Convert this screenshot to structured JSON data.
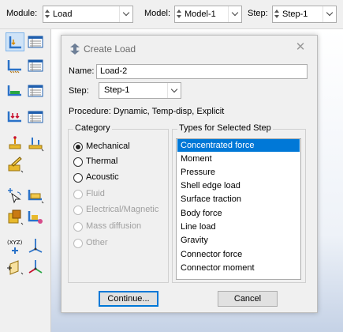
{
  "context_bar": {
    "module_label": "Module:",
    "module_value": "Load",
    "model_label": "Model:",
    "model_value": "Model-1",
    "step_label": "Step:",
    "step_value": "Step-1"
  },
  "toolbox": {
    "tools": [
      "create-load-icon",
      "load-manager-icon",
      "create-bc-icon",
      "bc-manager-icon",
      "create-predefined-field-icon",
      "predefined-field-manager-icon",
      "create-load-case-icon",
      "load-case-manager-icon",
      "create-datum-point-icon",
      "create-datum-axis-icon",
      "edit-attribute-icon",
      "query-icon",
      "partition-face-icon",
      "create-set-icon",
      "create-surface-icon",
      "create-coordinate-system-icon",
      "csys-axes-icon",
      "datum-plane-icon",
      "datum-csys-icon"
    ],
    "active_tool": "create-load-icon"
  },
  "dialog": {
    "title": "Create Load",
    "close_glyph": "✕",
    "name_label": "Name:",
    "name_value": "Load-2",
    "step_label": "Step:",
    "step_value": "Step-1",
    "procedure_text": "Procedure:  Dynamic, Temp-disp, Explicit",
    "category_title": "Category",
    "categories": [
      {
        "label": "Mechanical",
        "checked": true,
        "enabled": true
      },
      {
        "label": "Thermal",
        "checked": false,
        "enabled": true
      },
      {
        "label": "Acoustic",
        "checked": false,
        "enabled": true
      },
      {
        "label": "Fluid",
        "checked": false,
        "enabled": false
      },
      {
        "label": "Electrical/Magnetic",
        "checked": false,
        "enabled": false
      },
      {
        "label": "Mass diffusion",
        "checked": false,
        "enabled": false
      },
      {
        "label": "Other",
        "checked": false,
        "enabled": false
      }
    ],
    "types_title": "Types for Selected Step",
    "types": [
      "Concentrated force",
      "Moment",
      "Pressure",
      "Shell edge load",
      "Surface traction",
      "Body force",
      "Line load",
      "Gravity",
      "Connector force",
      "Connector moment"
    ],
    "selected_type": "Concentrated force",
    "continue_label": "Continue...",
    "cancel_label": "Cancel"
  },
  "colors": {
    "selection": "#0078d7",
    "dialog_bg": "#f0f0f0",
    "toolbar_bg": "#f0f0f0"
  }
}
